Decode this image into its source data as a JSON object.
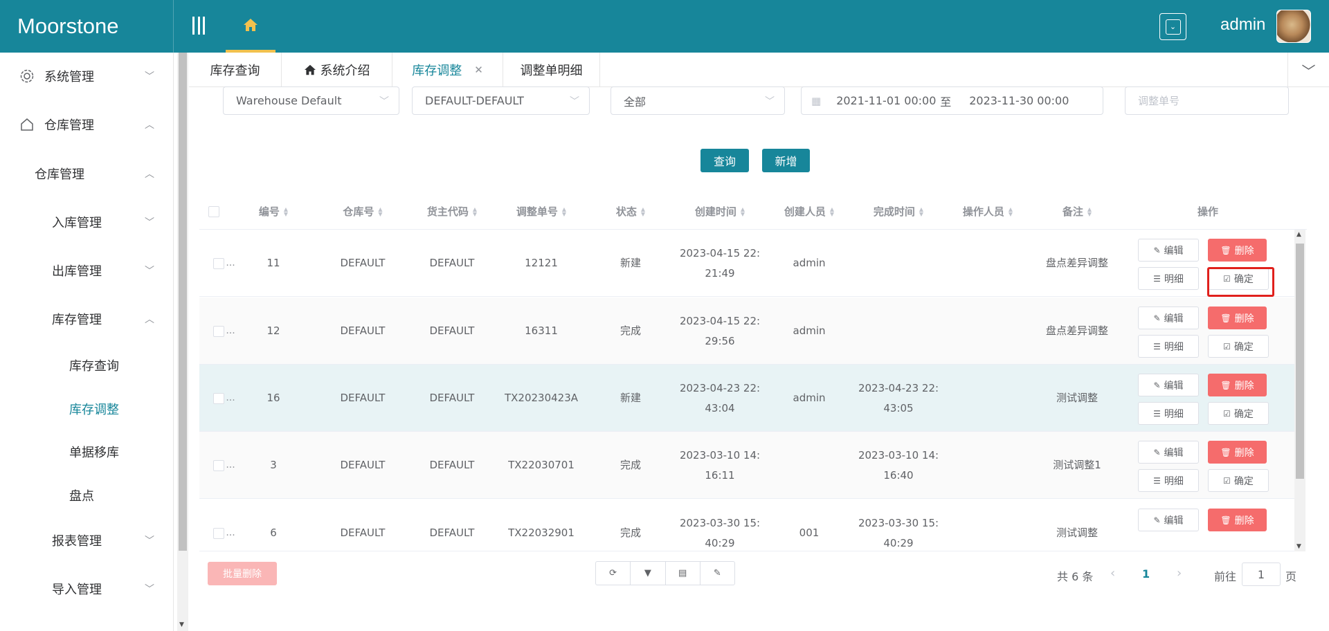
{
  "app": {
    "title": "Moorstone",
    "user": "admin"
  },
  "sidebar": {
    "items": [
      {
        "label": "系统管理"
      },
      {
        "label": "仓库管理"
      },
      {
        "label": "仓库管理"
      },
      {
        "label": "入库管理"
      },
      {
        "label": "出库管理"
      },
      {
        "label": "库存管理"
      },
      {
        "label": "库存查询"
      },
      {
        "label": "库存调整"
      },
      {
        "label": "单据移库"
      },
      {
        "label": "盘点"
      },
      {
        "label": "报表管理"
      },
      {
        "label": "导入管理"
      }
    ]
  },
  "tabs": [
    {
      "label": "库存查询"
    },
    {
      "label": "系统介绍"
    },
    {
      "label": "库存调整"
    },
    {
      "label": "调整单明细"
    }
  ],
  "filters": {
    "warehouse": "Warehouse Default",
    "owner": "DEFAULT-DEFAULT",
    "status": "全部",
    "date_start": "2021-11-01 00:00",
    "date_sep": "至",
    "date_end": "2023-11-30 00:00",
    "adjust_no_placeholder": "调整单号"
  },
  "buttons": {
    "query": "查询",
    "add": "新增",
    "batch_delete": "批量删除",
    "edit": "编辑",
    "delete": "删除",
    "detail": "明细",
    "confirm": "确定"
  },
  "table": {
    "headers": [
      "编号",
      "仓库号",
      "货主代码",
      "调整单号",
      "状态",
      "创建时间",
      "创建人员",
      "完成时间",
      "操作人员",
      "备注",
      "操作"
    ],
    "rows": [
      {
        "id": "11",
        "warehouse": "DEFAULT",
        "owner": "DEFAULT",
        "adjust_no": "12121",
        "status": "新建",
        "created_1": "2023-04-15 22:",
        "created_2": "21:49",
        "creator": "admin",
        "done_1": "",
        "done_2": "",
        "operator": "",
        "note": "盘点差异调整"
      },
      {
        "id": "12",
        "warehouse": "DEFAULT",
        "owner": "DEFAULT",
        "adjust_no": "16311",
        "status": "完成",
        "created_1": "2023-04-15 22:",
        "created_2": "29:56",
        "creator": "admin",
        "done_1": "",
        "done_2": "",
        "operator": "",
        "note": "盘点差异调整"
      },
      {
        "id": "16",
        "warehouse": "DEFAULT",
        "owner": "DEFAULT",
        "adjust_no": "TX20230423A",
        "status": "新建",
        "created_1": "2023-04-23 22:",
        "created_2": "43:04",
        "creator": "admin",
        "done_1": "2023-04-23 22:",
        "done_2": "43:05",
        "operator": "",
        "note": "测试调整"
      },
      {
        "id": "3",
        "warehouse": "DEFAULT",
        "owner": "DEFAULT",
        "adjust_no": "TX22030701",
        "status": "完成",
        "created_1": "2023-03-10 14:",
        "created_2": "16:11",
        "creator": "",
        "done_1": "2023-03-10 14:",
        "done_2": "16:40",
        "operator": "",
        "note": "测试调整1"
      },
      {
        "id": "6",
        "warehouse": "DEFAULT",
        "owner": "DEFAULT",
        "adjust_no": "TX22032901",
        "status": "完成",
        "created_1": "2023-03-30 15:",
        "created_2": "40:29",
        "creator": "001",
        "done_1": "2023-03-30 15:",
        "done_2": "40:29",
        "operator": "",
        "note": "测试调整"
      }
    ]
  },
  "pager": {
    "total": "共 6 条",
    "current": "1",
    "goto": "前往",
    "input": "1",
    "page": "页"
  },
  "colors": {
    "primary": "#17869a",
    "danger": "#f56c6c",
    "highlight": "#e0201c"
  }
}
